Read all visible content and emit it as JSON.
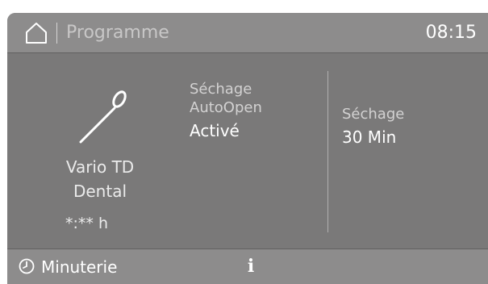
{
  "header": {
    "icon": "home-icon",
    "title": "Programme",
    "time": "08:15"
  },
  "program": {
    "icon": "dental-instrument-icon",
    "name_line1": "Vario TD",
    "name_line2": "Dental",
    "remaining_time": "*:** h"
  },
  "drying_autoopen": {
    "label_line1": "Séchage",
    "label_line2": "AutoOpen",
    "value": "Activé"
  },
  "drying": {
    "label": "Séchage",
    "value": "30 Min"
  },
  "footer": {
    "timer_icon": "clock-icon",
    "timer_label": "Minuterie",
    "info_icon": "info-icon",
    "info_glyph": "i"
  },
  "colors": {
    "display_background": "#7a7979",
    "bar_background": "#8d8c8c",
    "text_primary": "#ffffff",
    "text_secondary": "#d3d2d2"
  }
}
